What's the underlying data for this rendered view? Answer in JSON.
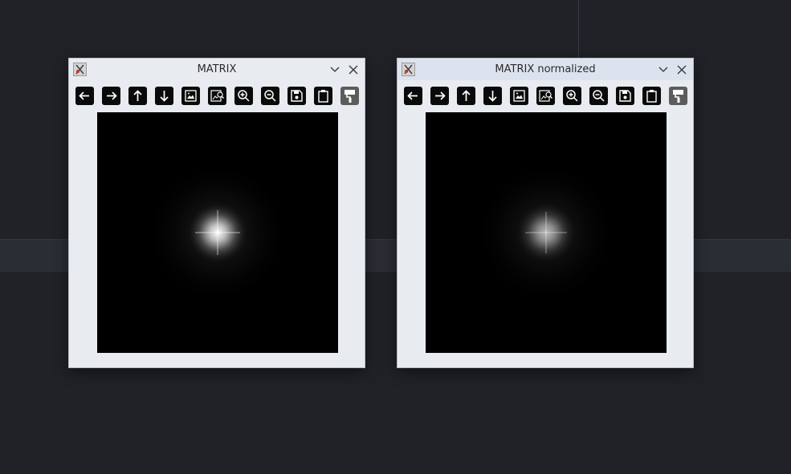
{
  "windows": [
    {
      "title": "MATRIX",
      "image": {
        "glow_opacity": 1.0
      }
    },
    {
      "title": "MATRIX normalized",
      "image": {
        "glow_opacity": 0.8
      }
    }
  ],
  "toolbar_icons": [
    "arrow-left-icon",
    "arrow-right-icon",
    "arrow-up-icon",
    "arrow-down-icon",
    "image-icon",
    "image-search-icon",
    "zoom-in-icon",
    "zoom-out-icon",
    "save-icon",
    "clipboard-icon",
    "paint-roller-icon"
  ],
  "colors": {
    "desktop": "#202227",
    "window_bg": "#e8ebf0",
    "toolbar_button": "#0a0a0a",
    "toolbar_button_active": "#5c5c5c"
  }
}
